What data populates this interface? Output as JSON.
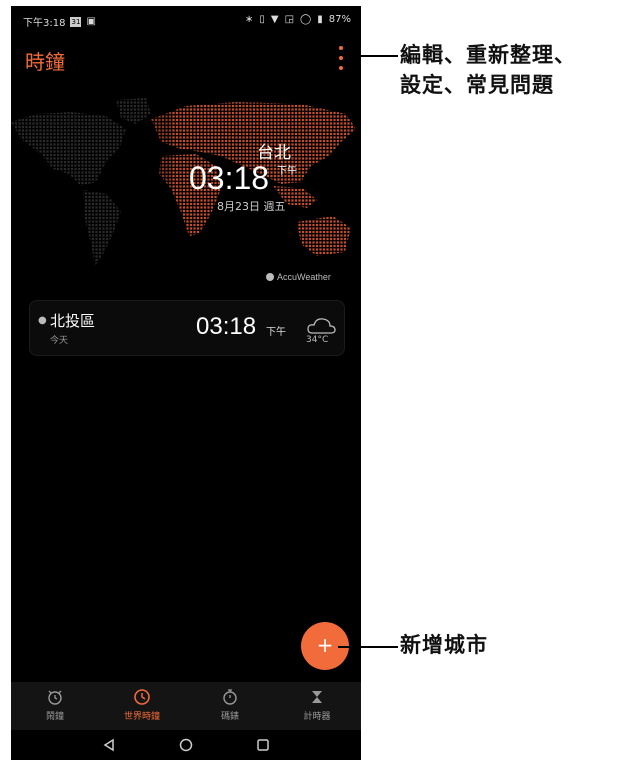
{
  "status_bar": {
    "time": "下午3:18",
    "calendar_badge": "31",
    "battery": "87%"
  },
  "app": {
    "title": "時鐘"
  },
  "world_map": {
    "city": "台北",
    "time": "03:18",
    "ampm": "下午",
    "date": "8月23日 週五",
    "provider": "AccuWeather"
  },
  "city_card": {
    "city": "北投區",
    "day": "今天",
    "time": "03:18",
    "ampm": "下午",
    "temperature": "34°C",
    "weather_icon": "cloudy-icon"
  },
  "fab": {
    "label": "+"
  },
  "bottom_nav": {
    "items": [
      {
        "label": "鬧鐘",
        "icon": "alarm-icon"
      },
      {
        "label": "世界時鐘",
        "icon": "clock-icon"
      },
      {
        "label": "碼錶",
        "icon": "stopwatch-icon"
      },
      {
        "label": "計時器",
        "icon": "hourglass-icon"
      }
    ]
  },
  "callouts": {
    "menu_line1": "編輯、重新整理、",
    "menu_line2": "設定、常見問題",
    "fab": "新增城市"
  },
  "colors": {
    "accent": "#f26b3a",
    "background": "#000000",
    "nav_background": "#141414"
  }
}
